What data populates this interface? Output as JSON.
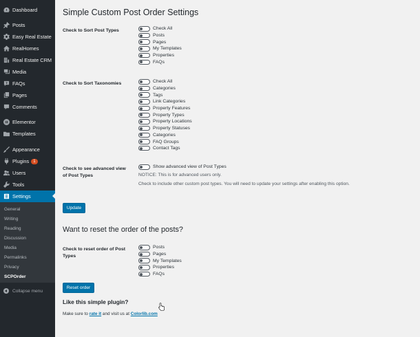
{
  "sidebar": {
    "items": [
      {
        "label": "Dashboard",
        "icon": "dashboard-icon"
      },
      {
        "label": "Posts",
        "icon": "pin-icon"
      },
      {
        "label": "Easy Real Estate",
        "icon": "gear-icon"
      },
      {
        "label": "RealHomes",
        "icon": "house-icon"
      },
      {
        "label": "Real Estate CRM",
        "icon": "building-icon"
      },
      {
        "label": "Media",
        "icon": "media-icon"
      },
      {
        "label": "FAQs",
        "icon": "faq-icon"
      },
      {
        "label": "Pages",
        "icon": "pages-icon"
      },
      {
        "label": "Comments",
        "icon": "comment-icon"
      },
      {
        "label": "Elementor",
        "icon": "elementor-icon"
      },
      {
        "label": "Templates",
        "icon": "folder-icon"
      },
      {
        "label": "Appearance",
        "icon": "brush-icon"
      },
      {
        "label": "Plugins",
        "icon": "plug-icon",
        "badge": "1"
      },
      {
        "label": "Users",
        "icon": "users-icon"
      },
      {
        "label": "Tools",
        "icon": "wrench-icon"
      },
      {
        "label": "Settings",
        "icon": "settings-icon"
      }
    ],
    "submenu": [
      "General",
      "Writing",
      "Reading",
      "Discussion",
      "Media",
      "Permalinks",
      "Privacy",
      "SCPOrder"
    ],
    "collapse_label": "Collapse menu"
  },
  "page": {
    "title": "Simple Custom Post Order Settings",
    "sort_post_types": {
      "label": "Check to Sort Post Types",
      "options": [
        "Check All",
        "Posts",
        "Pages",
        "My Templates",
        "Properties",
        "FAQs"
      ]
    },
    "sort_taxonomies": {
      "label": "Check to Sort Taxonomies",
      "options": [
        "Check All",
        "Categories",
        "Tags",
        "Link Categories",
        "Property Features",
        "Property Types",
        "Property Locations",
        "Property Statuses",
        "Categories",
        "FAQ Groups",
        "Contact Tags"
      ]
    },
    "advanced": {
      "label": "Check to see advanced view of Post Types",
      "option": "Show advanced view of Post Types",
      "notice": "NOTICE: This is for advanced users only.",
      "help": "Check to include other custom post types. You will need to update your settings after enabling this option."
    },
    "update_button": "Update",
    "reset_title": "Want to reset the order of the posts?",
    "reset": {
      "label": "Check to reset order of Post Types",
      "options": [
        "Posts",
        "Pages",
        "My Templates",
        "Properties",
        "FAQs"
      ]
    },
    "reset_button": "Reset order",
    "like_title": "Like this simple plugin?",
    "footer": {
      "prefix": "Make sure to ",
      "rate_link": "rate it",
      "middle": " and visit us at ",
      "site_link": "Colorlib.com"
    }
  },
  "colors": {
    "sidebar_bg": "#23282d",
    "accent": "#0073aa",
    "page_bg": "#f1f1f1"
  }
}
